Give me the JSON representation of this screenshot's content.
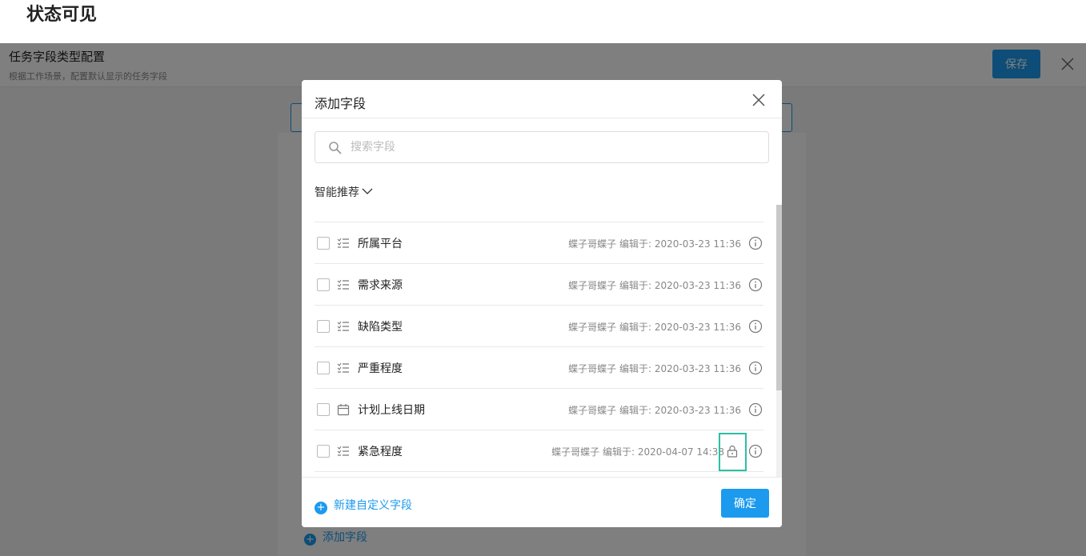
{
  "annotation": {
    "title": "状态可见"
  },
  "app": {
    "title": "任务字段类型配置",
    "subtitle": "根据工作场景，配置默认显示的任务字段",
    "save_label": "保存",
    "add_field_label": "添加字段"
  },
  "modal": {
    "title": "添加字段",
    "search": {
      "placeholder": "搜索字段"
    },
    "recommend_label": "智能推荐",
    "fields": [
      {
        "name": "所属平台",
        "type_icon": "list-icon",
        "editor": "蝶子哥蝶子",
        "edited_prefix": "编辑于:",
        "edited_at": "2020-03-23 11:36",
        "locked": false
      },
      {
        "name": "需求来源",
        "type_icon": "list-icon",
        "editor": "蝶子哥蝶子",
        "edited_prefix": "编辑于:",
        "edited_at": "2020-03-23 11:36",
        "locked": false
      },
      {
        "name": "缺陷类型",
        "type_icon": "list-icon",
        "editor": "蝶子哥蝶子",
        "edited_prefix": "编辑于:",
        "edited_at": "2020-03-23 11:36",
        "locked": false
      },
      {
        "name": "严重程度",
        "type_icon": "list-icon",
        "editor": "蝶子哥蝶子",
        "edited_prefix": "编辑于:",
        "edited_at": "2020-03-23 11:36",
        "locked": false
      },
      {
        "name": "计划上线日期",
        "type_icon": "calendar-icon",
        "editor": "蝶子哥蝶子",
        "edited_prefix": "编辑于:",
        "edited_at": "2020-03-23 11:36",
        "locked": false
      },
      {
        "name": "紧急程度",
        "type_icon": "list-icon",
        "editor": "蝶子哥蝶子",
        "edited_prefix": "编辑于:",
        "edited_at": "2020-04-07 14:38",
        "locked": true
      }
    ],
    "new_field_label": "新建自定义字段",
    "confirm_label": "确定"
  },
  "colors": {
    "accent": "#1b9aee",
    "highlight": "#2bc0a3"
  }
}
